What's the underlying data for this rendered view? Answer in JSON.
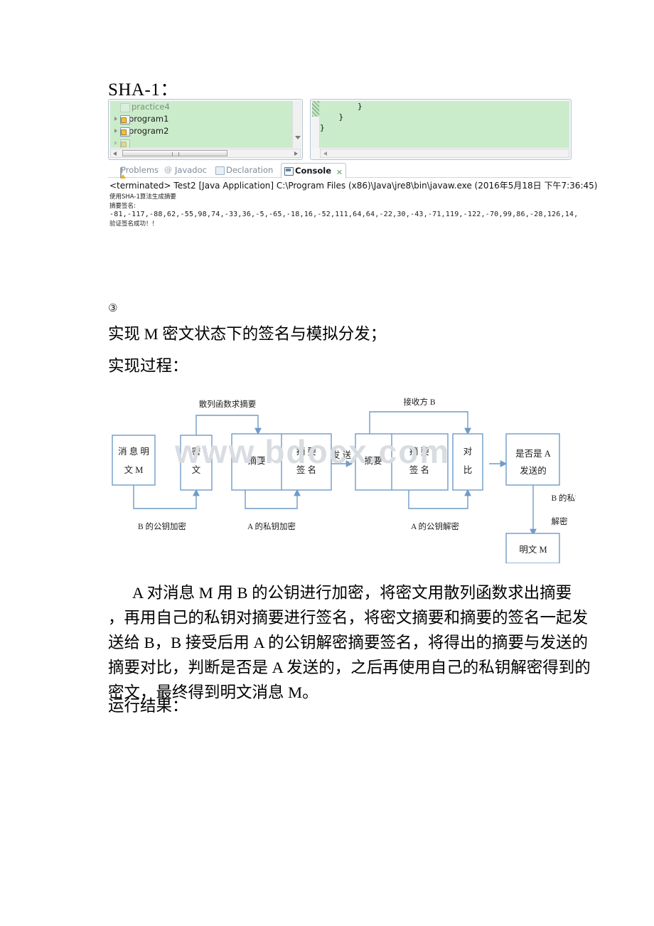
{
  "document": {
    "sha_heading": "SHA-1：",
    "section_marker": "③",
    "section_title": "实现 M 密文状态下的签名与模拟分发；",
    "process_title": "实现过程：",
    "result_title": "运行结果：",
    "paragraph_lines": [
      "A 对消息 M 用 B 的公钥进行加密，将密文用散列函数求出摘要",
      "，再用自己的私钥对摘要进行签名，将密文摘要和摘要的签名一起发",
      "送给 B，B 接受后用 A 的公钥解密摘要签名，将得出的摘要与发送的",
      "摘要对比，判断是否是 A 发送的，之后再使用自己的私钥解密得到的",
      "密文，最终得到明文消息 M。"
    ]
  },
  "ide": {
    "package_explorer": {
      "items": [
        {
          "label": "practice4",
          "icon": "folder-icon",
          "expandable": false,
          "faded": true
        },
        {
          "label": "program1",
          "icon": "java-project-icon",
          "expandable": true,
          "faded": false
        },
        {
          "label": "program2",
          "icon": "java-project-icon",
          "expandable": true,
          "faded": false
        }
      ]
    },
    "editor": {
      "code_lines": [
        "        }",
        "    }",
        "}"
      ]
    },
    "tabs": [
      {
        "label": "Problems",
        "icon": "problems-icon",
        "active": false
      },
      {
        "label": "Javadoc",
        "icon": "javadoc-icon",
        "active": false
      },
      {
        "label": "Declaration",
        "icon": "declaration-icon",
        "active": false
      },
      {
        "label": "Console",
        "icon": "console-icon",
        "active": true
      }
    ],
    "close_glyph": "✕",
    "javadoc_glyph": "@",
    "console": {
      "header": "<terminated> Test2 [Java Application] C:\\Program Files (x86)\\Java\\jre8\\bin\\javaw.exe (2016年5月18日 下午7:36:45)",
      "output_lines": [
        "使用SHA-1算法生成摘要",
        "摘要签名:",
        "-81,-117,-88,62,-55,98,74,-33,36,-5,-65,-18,16,-52,111,64,64,-22,30,-43,-71,119,-122,-70,99,86,-28,126,14,",
        "验证签名成功！！"
      ]
    }
  },
  "diagram": {
    "watermark": "www.bdocx.com",
    "boxes": [
      {
        "id": "plain-message",
        "lines": [
          "消息明",
          "文 M"
        ]
      },
      {
        "id": "ciphertext",
        "lines": [
          "密",
          "文"
        ]
      },
      {
        "id": "digest-sender",
        "lines": [
          "摘要"
        ]
      },
      {
        "id": "digest-signature-sender",
        "lines": [
          "摘 要",
          "签 名"
        ]
      },
      {
        "id": "digest-receiver",
        "lines": [
          "摘要"
        ]
      },
      {
        "id": "digest-signature-receiver",
        "lines": [
          "摘 要",
          "签 名"
        ]
      },
      {
        "id": "compare",
        "lines": [
          "对",
          "比"
        ]
      },
      {
        "id": "is-from-a",
        "lines": [
          "是否是 A",
          "发送的"
        ]
      },
      {
        "id": "plaintext-m",
        "lines": [
          "明文 M"
        ]
      }
    ],
    "labels": [
      {
        "id": "hash-digest",
        "text": "散列函数求摘要"
      },
      {
        "id": "receiver-b",
        "text": "接收方 B"
      },
      {
        "id": "send",
        "text": "发送"
      },
      {
        "id": "b-public-key-encrypt",
        "text": "B 的公钥加密"
      },
      {
        "id": "a-private-key-encrypt",
        "text": "A 的私钥加密"
      },
      {
        "id": "a-public-key-decrypt",
        "text": "A 的公钥解密"
      },
      {
        "id": "b-private-key-line1",
        "text": "B 的私钥"
      },
      {
        "id": "b-private-key-line2",
        "text": "解密"
      }
    ]
  },
  "colors": {
    "diagram_stroke": "#6f9bc8",
    "ide_tree_bg": "#cbeccb",
    "watermark": "#d9dde2"
  }
}
